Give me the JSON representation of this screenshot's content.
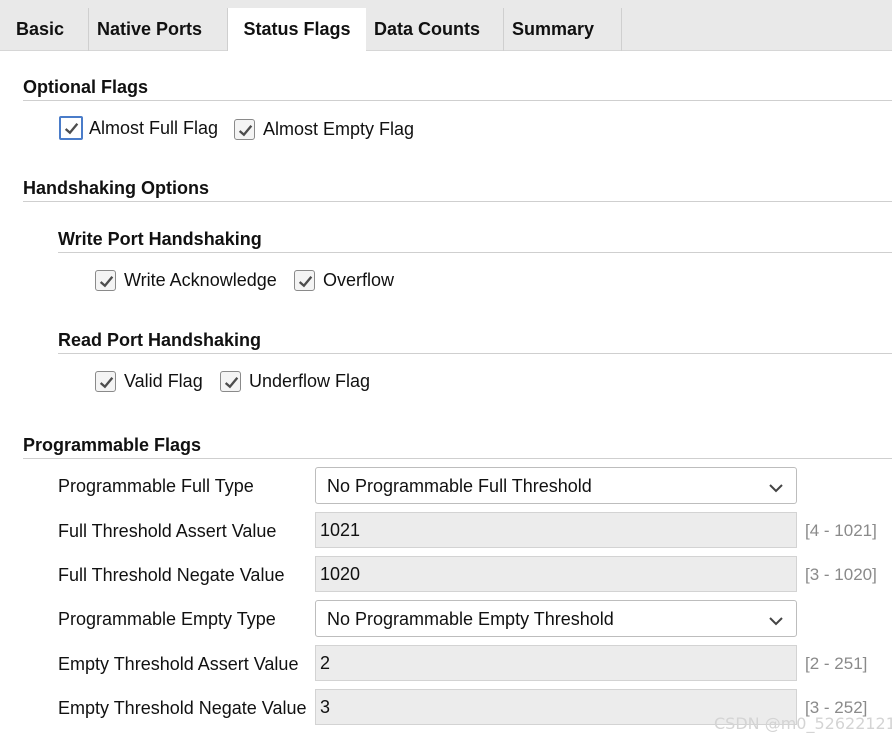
{
  "tabs": [
    {
      "label": "Basic"
    },
    {
      "label": "Native Ports"
    },
    {
      "label": "Status Flags",
      "active": true
    },
    {
      "label": "Data Counts"
    },
    {
      "label": "Summary"
    }
  ],
  "optional_flags": {
    "title": "Optional Flags",
    "almost_full": {
      "label": "Almost Full Flag",
      "checked": true
    },
    "almost_empty": {
      "label": "Almost Empty Flag",
      "checked": true
    }
  },
  "handshaking": {
    "title": "Handshaking Options",
    "write": {
      "title": "Write Port Handshaking",
      "write_ack": {
        "label": "Write Acknowledge",
        "checked": true
      },
      "overflow": {
        "label": "Overflow",
        "checked": true
      }
    },
    "read": {
      "title": "Read Port Handshaking",
      "valid": {
        "label": "Valid Flag",
        "checked": true
      },
      "underflow": {
        "label": "Underflow Flag",
        "checked": true
      }
    }
  },
  "programmable": {
    "title": "Programmable Flags",
    "full_type": {
      "label": "Programmable Full Type",
      "value": "No Programmable Full Threshold"
    },
    "full_assert": {
      "label": "Full Threshold Assert Value",
      "value": "1021",
      "range": "[4 - 1021]"
    },
    "full_negate": {
      "label": "Full Threshold Negate Value",
      "value": "1020",
      "range": "[3 - 1020]"
    },
    "empty_type": {
      "label": "Programmable Empty Type",
      "value": "No Programmable Empty Threshold"
    },
    "empty_assert": {
      "label": "Empty Threshold Assert Value",
      "value": "2",
      "range": "[2 - 251]"
    },
    "empty_negate": {
      "label": "Empty Threshold Negate Value",
      "value": "3",
      "range": "[3 - 252]"
    }
  },
  "watermark": "CSDN @m0_52622121",
  "colors": {
    "focus_border": "#4a7cc9",
    "disabled_field": "#ececec",
    "tab_bar": "#e9e9e9"
  }
}
